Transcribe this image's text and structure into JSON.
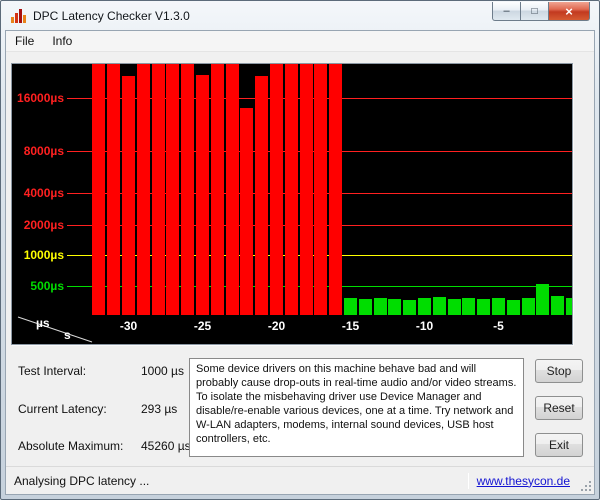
{
  "window": {
    "title": "DPC Latency Checker V1.3.0",
    "controls": {
      "minimize": "–",
      "maximize": "□",
      "close": "×"
    }
  },
  "menu": {
    "items": [
      {
        "label": "File"
      },
      {
        "label": "Info"
      }
    ]
  },
  "chart_data": {
    "type": "bar",
    "background": "#000000",
    "tick_color": "#ffffff",
    "y_axis": {
      "unit": "µs",
      "levels": [
        {
          "value": 16000,
          "label": "16000µs",
          "color": "#ff2020"
        },
        {
          "value": 8000,
          "label": "8000µs",
          "color": "#ff2020"
        },
        {
          "value": 4000,
          "label": "4000µs",
          "color": "#ff2020"
        },
        {
          "value": 2000,
          "label": "2000µs",
          "color": "#ff2020"
        },
        {
          "value": 1000,
          "label": "1000µs",
          "color": "#ffff00"
        },
        {
          "value": 500,
          "label": "500µs",
          "color": "#00dd00"
        }
      ]
    },
    "x_axis": {
      "unit": "s",
      "ticks": [
        -30,
        -25,
        -20,
        -15,
        -10,
        -5
      ]
    },
    "bar_colors": {
      "low": "#00dd00",
      "mid": "#ffff00",
      "high": "#ff0000"
    },
    "color_thresholds": {
      "low_max": 1000,
      "mid_max": 2000
    },
    "bars": [
      {
        "t": -32,
        "v": 45000
      },
      {
        "t": -31,
        "v": 45260
      },
      {
        "t": -30,
        "v": 27000
      },
      {
        "t": -29,
        "v": 44500
      },
      {
        "t": -28,
        "v": 45000
      },
      {
        "t": -27,
        "v": 44000
      },
      {
        "t": -26,
        "v": 45000
      },
      {
        "t": -25,
        "v": 27500
      },
      {
        "t": -24,
        "v": 44500
      },
      {
        "t": -23,
        "v": 45000
      },
      {
        "t": -22,
        "v": 14000
      },
      {
        "t": -21,
        "v": 27000
      },
      {
        "t": -20,
        "v": 45000
      },
      {
        "t": -19,
        "v": 44500
      },
      {
        "t": -18,
        "v": 45000
      },
      {
        "t": -17,
        "v": 44000
      },
      {
        "t": -16,
        "v": 45000
      },
      {
        "t": -15,
        "v": 290
      },
      {
        "t": -14,
        "v": 270
      },
      {
        "t": -13,
        "v": 300
      },
      {
        "t": -12,
        "v": 280
      },
      {
        "t": -11,
        "v": 260
      },
      {
        "t": -10,
        "v": 290
      },
      {
        "t": -9,
        "v": 310
      },
      {
        "t": -8,
        "v": 270
      },
      {
        "t": -7,
        "v": 290
      },
      {
        "t": -6,
        "v": 280
      },
      {
        "t": -5,
        "v": 300
      },
      {
        "t": -4,
        "v": 260
      },
      {
        "t": -3,
        "v": 290
      },
      {
        "t": -2,
        "v": 520
      },
      {
        "t": -1,
        "v": 330
      },
      {
        "t": 0,
        "v": 293
      }
    ]
  },
  "stats": {
    "rows": [
      {
        "label": "Test Interval:",
        "value": "1000 µs"
      },
      {
        "label": "Current Latency:",
        "value": "293 µs"
      },
      {
        "label": "Absolute Maximum:",
        "value": "45260 µs"
      }
    ]
  },
  "message": {
    "text": "Some device drivers on this machine behave bad and will probably cause drop-outs in real-time audio and/or video streams. To isolate the misbehaving driver use Device Manager and disable/re-enable various devices, one at a time. Try network and W-LAN adapters, modems, internal sound devices, USB host controllers, etc."
  },
  "actions": {
    "stop": "Stop",
    "reset": "Reset",
    "exit": "Exit"
  },
  "statusbar": {
    "text": "Analysing DPC latency ...",
    "link": "www.thesycon.de"
  }
}
